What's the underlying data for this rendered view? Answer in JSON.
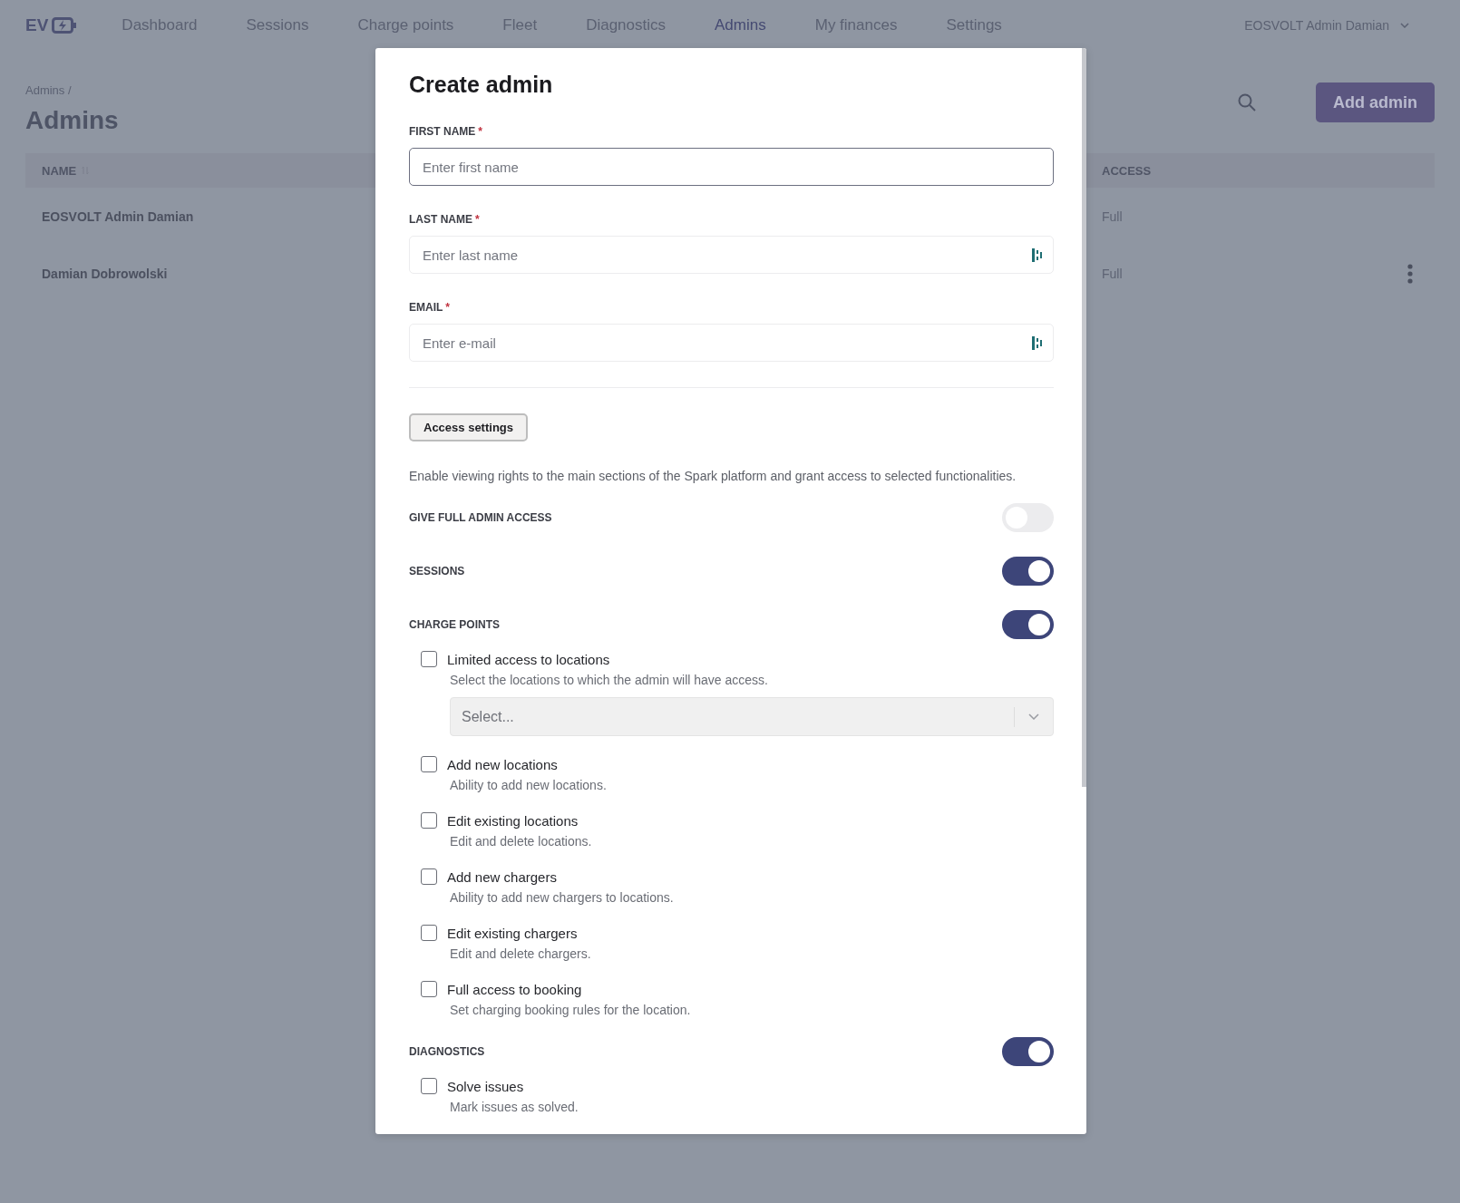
{
  "nav": {
    "logo": "EV",
    "items": [
      {
        "label": "Dashboard",
        "selected": false
      },
      {
        "label": "Sessions",
        "selected": false
      },
      {
        "label": "Charge points",
        "selected": false
      },
      {
        "label": "Fleet",
        "selected": false
      },
      {
        "label": "Diagnostics",
        "selected": false
      },
      {
        "label": "Admins",
        "selected": true
      },
      {
        "label": "My finances",
        "selected": false
      },
      {
        "label": "Settings",
        "selected": false
      }
    ],
    "user": "EOSVOLT Admin Damian"
  },
  "breadcrumb": "Admins /",
  "page_title": "Admins",
  "add_button": "Add admin",
  "table": {
    "columns": [
      "NAME",
      "ACCESS"
    ],
    "rows": [
      {
        "name": "EOSVOLT Admin Damian",
        "access": "Full"
      },
      {
        "name": "Damian Dobrowolski",
        "access": "Full",
        "menu": true
      }
    ]
  },
  "modal": {
    "title": "Create admin",
    "fields": [
      {
        "label": "FIRST NAME",
        "required_mark": "*",
        "placeholder": "Enter first name",
        "focused": true,
        "autofill_icon": false
      },
      {
        "label": "LAST NAME",
        "required_mark": "*",
        "placeholder": "Enter last name",
        "focused": false,
        "autofill_icon": true
      },
      {
        "label": "EMAIL",
        "required_mark": "*",
        "placeholder": "Enter e-mail",
        "focused": false,
        "autofill_icon": true
      }
    ],
    "section_button": "Access settings",
    "description": "Enable viewing rights to the main sections of the Spark platform and grant access to selected functionalities.",
    "sections": [
      {
        "label": "GIVE FULL ADMIN ACCESS",
        "on": false
      },
      {
        "label": "SESSIONS",
        "on": true
      },
      {
        "label": "CHARGE POINTS",
        "on": true,
        "options": [
          {
            "label": "Limited access to locations",
            "description": "Select the locations to which the admin will have access.",
            "checked": false,
            "select_placeholder": "Select..."
          },
          {
            "label": "Add new locations",
            "description": "Ability to add new locations.",
            "checked": false
          },
          {
            "label": "Edit existing locations",
            "description": "Edit and delete locations.",
            "checked": false
          },
          {
            "label": "Add new chargers",
            "description": "Ability to add new chargers to locations.",
            "checked": false
          },
          {
            "label": "Edit existing chargers",
            "description": "Edit and delete chargers.",
            "checked": false
          },
          {
            "label": "Full access to booking",
            "description": "Set charging booking rules for the location.",
            "checked": false
          }
        ]
      },
      {
        "label": "DIAGNOSTICS",
        "on": true,
        "options": [
          {
            "label": "Solve issues",
            "description": "Mark issues as solved.",
            "checked": false
          }
        ]
      }
    ]
  }
}
